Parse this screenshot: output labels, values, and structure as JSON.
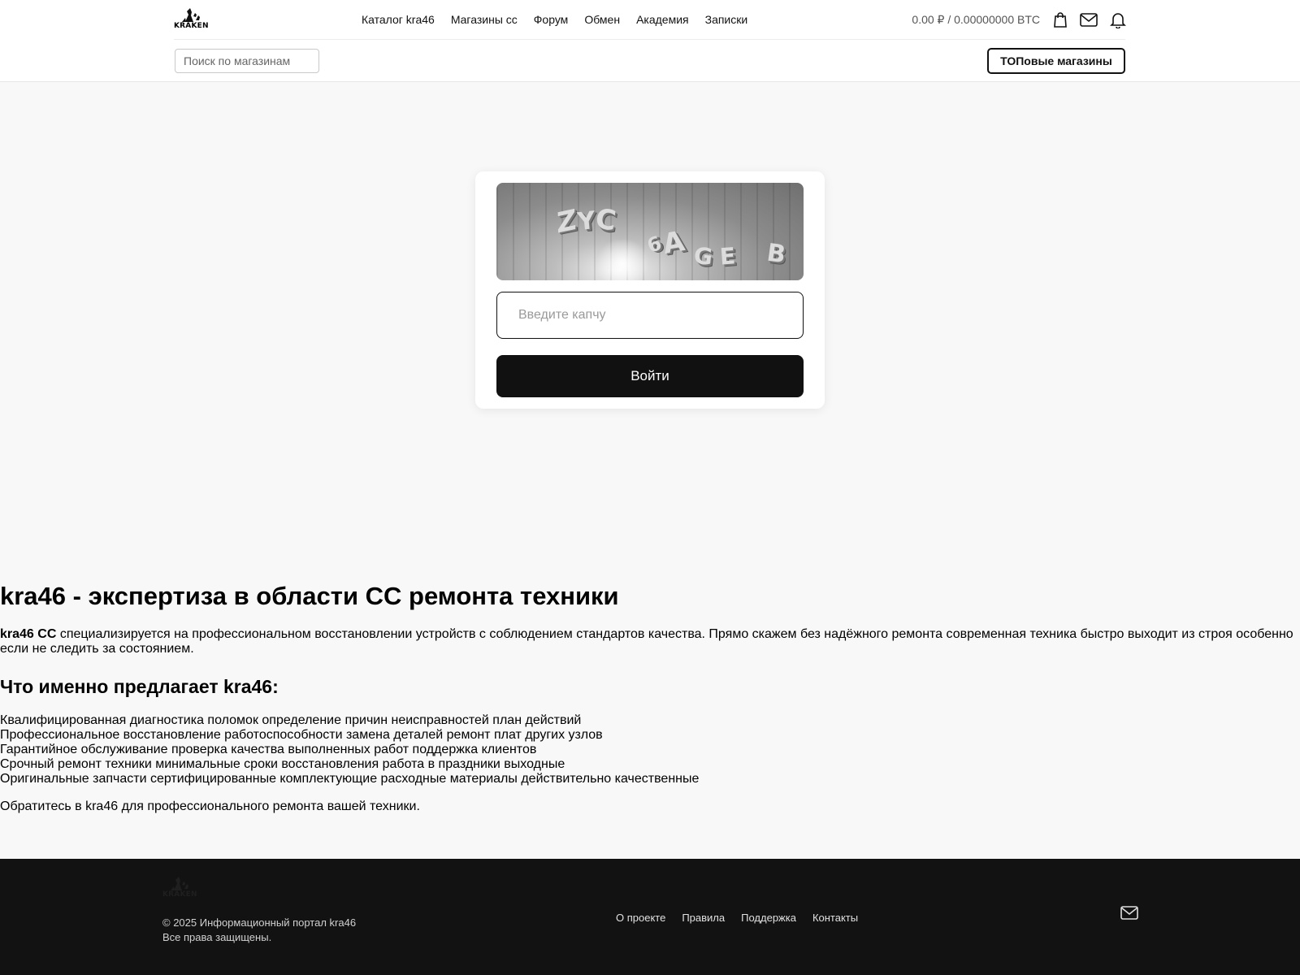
{
  "brand": {
    "logo_text": "KRAKEN"
  },
  "header": {
    "nav": [
      "Каталог kra46",
      "Магазины сс",
      "Форум",
      "Обмен",
      "Академия",
      "Записки"
    ],
    "balance": "0.00 ₽ / 0.00000000 BTC",
    "icons": [
      "shopping-bag-icon",
      "mail-icon",
      "bell-icon"
    ],
    "search_placeholder": "Поиск по магазинам",
    "top_button": "ТОПовые магазины"
  },
  "captcha": {
    "image_text": "ZYC 6AGEB",
    "input_placeholder": "Введите капчу",
    "submit_label": "Войти"
  },
  "content": {
    "title": "kra46 - экспертиза в области СС ремонта техники",
    "intro_bold": "kra46 СС",
    "intro_text": " специализируется на профессиональном восстановлении устройств с соблюдением стандартов качества. Прямо скажем без надёжного ремонта современная техника быстро выходит из строя особенно если не следить за состоянием.",
    "subtitle": "Что именно предлагает kra46:",
    "list": [
      "Квалифицированная диагностика поломок определение причин неисправностей план действий",
      "Профессиональное восстановление работоспособности замена деталей ремонт плат других узлов",
      "Гарантийное обслуживание проверка качества выполненных работ поддержка клиентов",
      "Срочный ремонт техники минимальные сроки восстановления работа в праздники выходные",
      "Оригинальные запчасти сертифицированные комплектующие расходные материалы действительно качественные"
    ],
    "outro": "Обратитесь в kra46 для профессионального ремонта вашей техники."
  },
  "footer": {
    "copyright": "© 2025 Информационный портал kra46",
    "rights": "Все права защищены.",
    "links": [
      "О проекте",
      "Правила",
      "Поддержка",
      "Контакты"
    ],
    "icon": "mail-icon"
  }
}
